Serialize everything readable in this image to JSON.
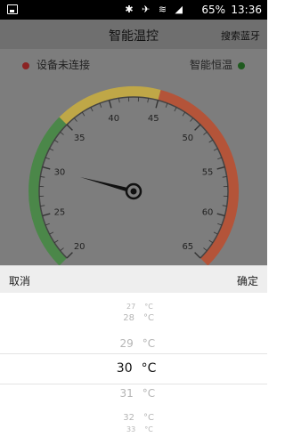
{
  "status_bar": {
    "icons": "✱ ✈ ≋ ◢",
    "battery": "65%",
    "time": "13:36"
  },
  "navbar": {
    "title": "智能温控",
    "search_label": "搜索蓝牙"
  },
  "connection": {
    "left_label": "设备未连接",
    "right_label": "智能恒温",
    "left_color": "#8b2323",
    "right_color": "#1f5a1f"
  },
  "gauge": {
    "min": 20,
    "max": 65,
    "tick_labels": [
      "20",
      "25",
      "30",
      "35",
      "40",
      "45",
      "50",
      "55",
      "60",
      "65"
    ],
    "needle_value": 30,
    "segments": [
      {
        "from": 20,
        "to": 35,
        "color": "#3f8a3c"
      },
      {
        "from": 35,
        "to": 45,
        "color": "#cfb23a"
      },
      {
        "from": 45,
        "to": 65,
        "color": "#c24a28"
      }
    ]
  },
  "dialog": {
    "cancel_label": "取消",
    "confirm_label": "确定"
  },
  "picker": {
    "unit": "°C",
    "options": [
      "27",
      "28",
      "29",
      "30",
      "31",
      "32",
      "33"
    ],
    "selected": "30"
  }
}
